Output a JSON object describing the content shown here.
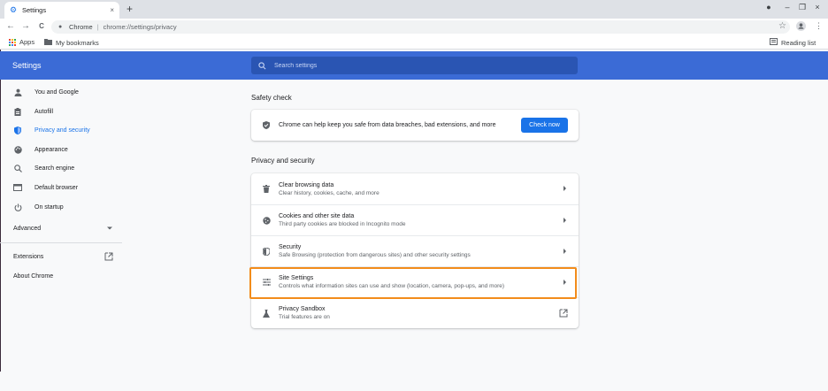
{
  "tab": {
    "title": "Settings",
    "close": "×"
  },
  "new_tab": "+",
  "toolbar": {
    "back": "←",
    "forward": "→",
    "reload": "C",
    "omnibox_host": "Chrome",
    "omnibox_sep": "|",
    "omnibox_url": "chrome://settings/privacy"
  },
  "bookmarks": {
    "apps": "Apps",
    "my_bookmarks": "My bookmarks",
    "reading_list": "Reading list"
  },
  "header": {
    "title": "Settings",
    "search_placeholder": "Search settings"
  },
  "sidebar": {
    "items": [
      {
        "label": "You and Google",
        "icon": "person-icon"
      },
      {
        "label": "Autofill",
        "icon": "clipboard-icon"
      },
      {
        "label": "Privacy and security",
        "icon": "shield-icon",
        "active": true
      },
      {
        "label": "Appearance",
        "icon": "palette-icon"
      },
      {
        "label": "Search engine",
        "icon": "search-icon"
      },
      {
        "label": "Default browser",
        "icon": "browser-icon"
      },
      {
        "label": "On startup",
        "icon": "power-icon"
      }
    ],
    "advanced": "Advanced",
    "extensions": "Extensions",
    "about": "About Chrome"
  },
  "safety_check": {
    "title": "Safety check",
    "text": "Chrome can help keep you safe from data breaches, bad extensions, and more",
    "button": "Check now"
  },
  "privacy": {
    "title": "Privacy and security",
    "rows": [
      {
        "title": "Clear browsing data",
        "sub": "Clear history, cookies, cache, and more",
        "icon": "trash-icon"
      },
      {
        "title": "Cookies and other site data",
        "sub": "Third party cookies are blocked in Incognito mode",
        "icon": "cookie-icon"
      },
      {
        "title": "Security",
        "sub": "Safe Browsing (protection from dangerous sites) and other security settings",
        "icon": "shield-icon"
      },
      {
        "title": "Site Settings",
        "sub": "Controls what information sites can use and show (location, camera, pop-ups, and more)",
        "icon": "sliders-icon"
      },
      {
        "title": "Privacy Sandbox",
        "sub": "Trial features are on",
        "icon": "flask-icon"
      }
    ]
  },
  "colors": {
    "header_bg": "#3b6bd6",
    "accent": "#1a73e8",
    "highlight": "#f28c1b"
  }
}
